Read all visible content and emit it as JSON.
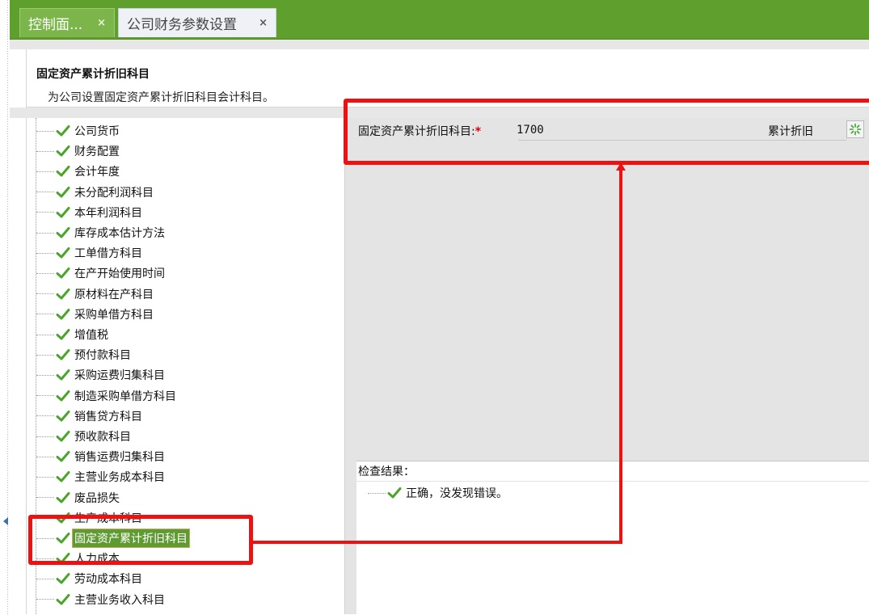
{
  "tabs": [
    {
      "label": "控制面...",
      "close": "×",
      "active": true
    },
    {
      "label": "公司财务参数设置",
      "close": "×",
      "active": false
    }
  ],
  "header": {
    "title": "固定资产累计折旧科目",
    "description": "为公司设置固定资产累计折旧科目会计科目。"
  },
  "tree": {
    "items": [
      {
        "label": "公司货币"
      },
      {
        "label": "财务配置"
      },
      {
        "label": "会计年度"
      },
      {
        "label": "未分配利润科目"
      },
      {
        "label": "本年利润科目"
      },
      {
        "label": "库存成本估计方法"
      },
      {
        "label": "工单借方科目"
      },
      {
        "label": "在产开始使用时间"
      },
      {
        "label": "原材料在产科目"
      },
      {
        "label": "采购单借方科目"
      },
      {
        "label": "增值税"
      },
      {
        "label": "预付款科目"
      },
      {
        "label": "采购运费归集科目"
      },
      {
        "label": "制造采购单借方科目"
      },
      {
        "label": "销售贷方科目"
      },
      {
        "label": "预收款科目"
      },
      {
        "label": "销售运费归集科目"
      },
      {
        "label": "主营业务成本科目"
      },
      {
        "label": "废品损失"
      },
      {
        "label": "生产成本科目"
      },
      {
        "label": "固定资产累计折旧科目",
        "selected": true
      },
      {
        "label": "人力成本"
      },
      {
        "label": "劳动成本科目"
      },
      {
        "label": "主营业务收入科目"
      }
    ]
  },
  "form": {
    "field_label": "固定资产累计折旧科目:",
    "required_mark": "*",
    "field_value": "1700",
    "field_name": "累计折旧"
  },
  "check_result": {
    "title": "检查结果：",
    "message": "正确，没发现错误。"
  },
  "colors": {
    "tab_bar": "#5f9f2e",
    "check_icon": "#4aa52a",
    "annotation": "#ee1111"
  }
}
